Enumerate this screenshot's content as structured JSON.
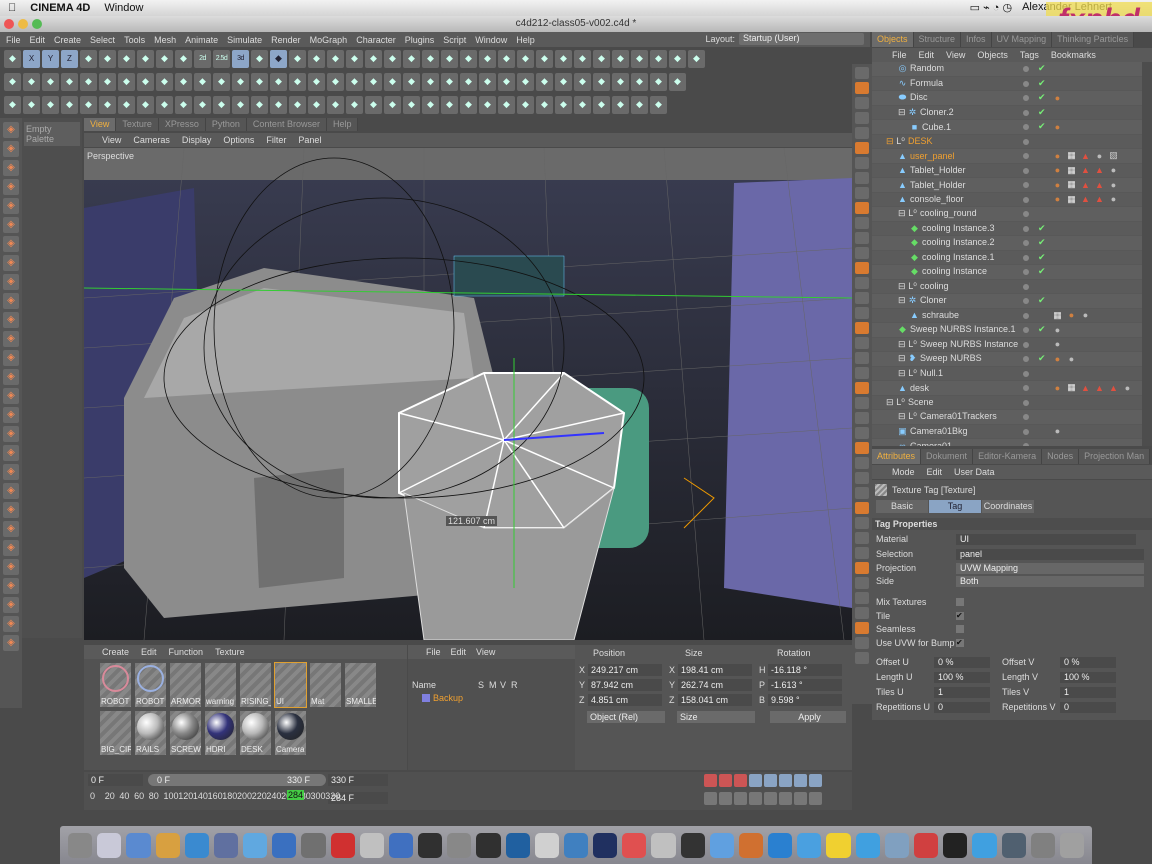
{
  "mac_menu": {
    "app": "CINEMA 4D",
    "items": [
      "Window"
    ],
    "user": "Alexander Lehnert"
  },
  "window_title": "c4d212-class05-v002.c4d *",
  "menu": [
    "File",
    "Edit",
    "Create",
    "Select",
    "Tools",
    "Mesh",
    "Animate",
    "Simulate",
    "Render",
    "MoGraph",
    "Character",
    "Plugins",
    "Script",
    "Window",
    "Help"
  ],
  "layout": {
    "label": "Layout:",
    "value": "Startup (User)"
  },
  "toolbar_rows": [
    [
      "undo",
      "x-axis",
      "y-axis",
      "z-axis",
      "world",
      "model",
      "points",
      "edges",
      "polys",
      "live-select",
      "2d",
      "2.5d",
      "3d",
      "move",
      "scale",
      "rotate",
      "spline",
      "bend",
      "twist",
      "taper",
      "bulge",
      "knife",
      "render-view",
      "render",
      "edit-render",
      "picture-viewer",
      "mograph",
      "cloner",
      "fracture",
      "voronoi",
      "matrix",
      "effector",
      "render-queue",
      "interactive",
      "lights",
      "camera",
      "target"
    ],
    [
      "cube",
      "sphere",
      "plastic",
      "light",
      "null",
      "capsule",
      "brush",
      "paint",
      "cloth",
      "grid",
      "bevel",
      "extrude",
      "loft",
      "sweep",
      "lathe",
      "symmetry",
      "boole",
      "connect",
      "instance",
      "array",
      "metaball",
      "atom",
      "hypernurbs",
      "deformer",
      "bend",
      "shear",
      "squash",
      "twist",
      "taper",
      "pose",
      "morph",
      "fracture",
      "tracer",
      "sky",
      "floor",
      "environment"
    ],
    [
      "cloner",
      "matrix",
      "fracture",
      "mospline",
      "text",
      "extrude",
      "instance",
      "tracer",
      "plain",
      "delay",
      "formula",
      "inheritance",
      "random",
      "shader",
      "sound",
      "spline",
      "step",
      "target",
      "time",
      "volume",
      "particle",
      "emitter",
      "attractor",
      "deflector",
      "friction",
      "gravity",
      "rotation",
      "turbulence",
      "wind",
      "character",
      "joint",
      "ik",
      "weight",
      "measure",
      "lock"
    ]
  ],
  "palette": {
    "label": "Empty Palette"
  },
  "view_tabs": [
    {
      "label": "View",
      "active": true
    },
    {
      "label": "Texture"
    },
    {
      "label": "XPresso"
    },
    {
      "label": "Python"
    },
    {
      "label": "Content Browser"
    },
    {
      "label": "Help"
    }
  ],
  "viewport_menu": [
    "View",
    "Cameras",
    "Display",
    "Options",
    "Filter",
    "Panel"
  ],
  "viewport": {
    "label": "Perspective",
    "readout": "121.607 cm"
  },
  "objects_tabs": [
    {
      "label": "Objects",
      "active": true
    },
    {
      "label": "Structure"
    },
    {
      "label": "Infos"
    },
    {
      "label": "UV Mapping"
    },
    {
      "label": "Thinking Particles"
    }
  ],
  "objects_menu": [
    "File",
    "Edit",
    "View",
    "Objects",
    "Tags",
    "Bookmarks"
  ],
  "objects": [
    {
      "name": "Random",
      "indent": 1,
      "icon": "effector",
      "check": true
    },
    {
      "name": "Formula",
      "indent": 1,
      "icon": "formula",
      "check": true
    },
    {
      "name": "Disc",
      "indent": 1,
      "icon": "disc",
      "check": true,
      "tags": [
        "phong"
      ]
    },
    {
      "name": "Cloner.2",
      "indent": 1,
      "icon": "cloner",
      "check": true,
      "expand": true
    },
    {
      "name": "Cube.1",
      "indent": 2,
      "icon": "cube",
      "check": true,
      "tags": [
        "phong"
      ]
    },
    {
      "name": "DESK",
      "indent": 0,
      "icon": "null",
      "highlight": true,
      "expand": true
    },
    {
      "name": "user_panel",
      "indent": 1,
      "icon": "polygon",
      "highlight": true,
      "tags": [
        "phong",
        "uvw",
        "selection",
        "material",
        "texture"
      ]
    },
    {
      "name": "Tablet_Holder",
      "indent": 1,
      "icon": "polygon",
      "tags": [
        "phong",
        "uvw",
        "selection",
        "selection",
        "material"
      ]
    },
    {
      "name": "Tablet_Holder",
      "indent": 1,
      "icon": "polygon",
      "tags": [
        "phong",
        "uvw",
        "selection",
        "selection",
        "material"
      ]
    },
    {
      "name": "console_floor",
      "indent": 1,
      "icon": "polygon",
      "tags": [
        "phong",
        "uvw",
        "selection",
        "selection",
        "material"
      ]
    },
    {
      "name": "cooling_round",
      "indent": 1,
      "icon": "null",
      "expand": true
    },
    {
      "name": "cooling Instance.3",
      "indent": 2,
      "icon": "instance",
      "check": true
    },
    {
      "name": "cooling Instance.2",
      "indent": 2,
      "icon": "instance",
      "check": true
    },
    {
      "name": "cooling Instance.1",
      "indent": 2,
      "icon": "instance",
      "check": true
    },
    {
      "name": "cooling Instance",
      "indent": 2,
      "icon": "instance",
      "check": true
    },
    {
      "name": "cooling",
      "indent": 1,
      "icon": "null",
      "expand": true
    },
    {
      "name": "Cloner",
      "indent": 1,
      "icon": "cloner",
      "check": true,
      "expand": true
    },
    {
      "name": "schraube",
      "indent": 2,
      "icon": "polygon",
      "tags": [
        "uvw",
        "phong",
        "material"
      ]
    },
    {
      "name": "Sweep NURBS Instance.1",
      "indent": 1,
      "icon": "instance",
      "check": true,
      "tags": [
        "material"
      ]
    },
    {
      "name": "Sweep NURBS Instance",
      "indent": 1,
      "icon": "null",
      "expand": true,
      "tags": [
        "material"
      ]
    },
    {
      "name": "Sweep NURBS",
      "indent": 1,
      "icon": "sweep",
      "check": true,
      "expand": true,
      "tags": [
        "phong",
        "material"
      ]
    },
    {
      "name": "Null.1",
      "indent": 1,
      "icon": "null",
      "expand": true
    },
    {
      "name": "desk",
      "indent": 1,
      "icon": "polygon",
      "tags": [
        "phong",
        "uvw",
        "selection",
        "selection",
        "selection",
        "material"
      ]
    },
    {
      "name": "Scene",
      "indent": 0,
      "icon": "null",
      "expand": true
    },
    {
      "name": "Camera01Trackers",
      "indent": 1,
      "icon": "null",
      "expand": true
    },
    {
      "name": "Camera01Bkg",
      "indent": 1,
      "icon": "background",
      "tags": [
        "material"
      ]
    },
    {
      "name": "Camera01",
      "indent": 1,
      "icon": "camera"
    }
  ],
  "attributes_tabs": [
    {
      "label": "Attributes",
      "active": true
    },
    {
      "label": "Dokument"
    },
    {
      "label": "Editor-Kamera"
    },
    {
      "label": "Nodes"
    },
    {
      "label": "Projection Man"
    }
  ],
  "attributes_menu": [
    "Mode",
    "Edit",
    "User Data"
  ],
  "attributes": {
    "title": "Texture Tag [Texture]",
    "tabs": [
      {
        "label": "Basic"
      },
      {
        "label": "Tag",
        "active": true
      },
      {
        "label": "Coordinates"
      }
    ],
    "section": "Tag Properties",
    "material": {
      "label": "Material",
      "value": "UI"
    },
    "selection": {
      "label": "Selection",
      "value": "panel"
    },
    "projection": {
      "label": "Projection",
      "value": "UVW Mapping"
    },
    "side": {
      "label": "Side",
      "value": "Both"
    },
    "checks": [
      {
        "label": "Mix Textures",
        "checked": false
      },
      {
        "label": "Tile",
        "checked": true
      },
      {
        "label": "Seamless",
        "checked": false
      },
      {
        "label": "Use UVW for Bump",
        "checked": true
      }
    ],
    "pairs": [
      {
        "l1": "Offset U",
        "v1": "0 %",
        "l2": "Offset V",
        "v2": "0 %"
      },
      {
        "l1": "Length U",
        "v1": "100 %",
        "l2": "Length V",
        "v2": "100 %"
      },
      {
        "l1": "Tiles U",
        "v1": "1",
        "l2": "Tiles V",
        "v2": "1"
      },
      {
        "l1": "Repetitions U",
        "v1": "0",
        "l2": "Repetitions V",
        "v2": "0"
      }
    ]
  },
  "material_menu": [
    "Create",
    "Edit",
    "Function",
    "Texture"
  ],
  "materials": [
    {
      "name": "ROBOT",
      "color": "#d88a9a",
      "ring": true
    },
    {
      "name": "ROBOT",
      "color": "#9ab0e0",
      "ring": true
    },
    {
      "name": "ARMOR"
    },
    {
      "name": "warning"
    },
    {
      "name": "RISING_"
    },
    {
      "name": "UI",
      "selected": true
    },
    {
      "name": "Mat"
    },
    {
      "name": "SMALLE"
    },
    {
      "name": "BIG_CIR"
    },
    {
      "name": "RAILS",
      "color": "#bbbbbb"
    },
    {
      "name": "SCREW",
      "color": "#888888"
    },
    {
      "name": "HDRI",
      "color": "#33337a"
    },
    {
      "name": "DESK",
      "color": "#b8b8b8"
    },
    {
      "name": "Camera",
      "color": "#2a3040"
    }
  ],
  "layers": {
    "menu": [
      "File",
      "Edit",
      "View"
    ],
    "columns": [
      "Name",
      "S",
      "M",
      "V",
      "R"
    ],
    "rows": [
      {
        "name": "Backup",
        "color": "#8080e0"
      }
    ]
  },
  "coords": {
    "headers": [
      "Position",
      "Size",
      "Rotation"
    ],
    "rows": [
      {
        "a": "X",
        "p": "249.217 cm",
        "b": "X",
        "s": "198.41 cm",
        "c": "H",
        "r": "-16.118 °"
      },
      {
        "a": "Y",
        "p": "87.942 cm",
        "b": "Y",
        "s": "262.74 cm",
        "c": "P",
        "r": "-1.613 °"
      },
      {
        "a": "Z",
        "p": "4.851 cm",
        "b": "Z",
        "s": "158.041 cm",
        "c": "B",
        "r": "9.598 °"
      }
    ],
    "mode": "Object (Rel)",
    "size_mode": "Size",
    "apply": "Apply"
  },
  "timeline": {
    "start": "0 F",
    "slider_start": "0 F",
    "slider_end": "330 F",
    "end": "330 F",
    "current": "284 F",
    "current_marker": "284",
    "ticks": [
      "0",
      "20",
      "40",
      "60",
      "80",
      "100",
      "120",
      "140",
      "160",
      "180",
      "200",
      "220",
      "240",
      "260",
      "280",
      "300",
      "320"
    ]
  },
  "watermark": "fxphd",
  "dock_colors": [
    "#888",
    "#c9c9d8",
    "#5a8ad0",
    "#d8a040",
    "#3a8ad0",
    "#6070a0",
    "#60a8e0",
    "#3a70c0",
    "#707070",
    "#d03030",
    "#c0c0c0",
    "#4070c0",
    "#303030",
    "#888",
    "#303030",
    "#2060a0",
    "#d0d0d0",
    "#4080c0",
    "#203060",
    "#e05050",
    "#c0c0c0",
    "#333",
    "#60a0e0",
    "#d07030",
    "#2a80d0",
    "#4aa0e0",
    "#f0d030",
    "#40a0e0",
    "#80a0c0",
    "#d04040",
    "#222",
    "#40a0e0",
    "#506070",
    "#808080",
    "#a0a0a0"
  ]
}
